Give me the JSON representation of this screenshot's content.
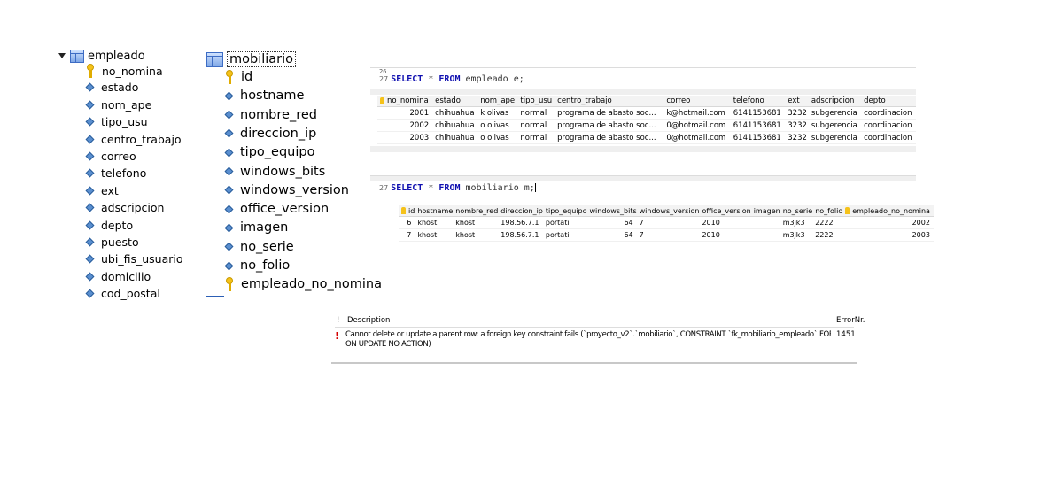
{
  "tree_empleado": {
    "title": "empleado",
    "columns": [
      {
        "name": "no_nomina",
        "icon": "primary-key-icon"
      },
      {
        "name": "estado",
        "icon": "column-icon"
      },
      {
        "name": "nom_ape",
        "icon": "column-icon"
      },
      {
        "name": "tipo_usu",
        "icon": "column-icon"
      },
      {
        "name": "centro_trabajo",
        "icon": "column-icon"
      },
      {
        "name": "correo",
        "icon": "column-icon"
      },
      {
        "name": "telefono",
        "icon": "column-icon"
      },
      {
        "name": "ext",
        "icon": "column-icon"
      },
      {
        "name": "adscripcion",
        "icon": "column-icon"
      },
      {
        "name": "depto",
        "icon": "column-icon"
      },
      {
        "name": "puesto",
        "icon": "column-icon"
      },
      {
        "name": "ubi_fis_usuario",
        "icon": "column-icon"
      },
      {
        "name": "domicilio",
        "icon": "column-icon"
      },
      {
        "name": "cod_postal",
        "icon": "column-icon"
      }
    ]
  },
  "tree_mobiliario": {
    "title": "mobiliario",
    "columns": [
      {
        "name": "id",
        "icon": "primary-key-icon"
      },
      {
        "name": "hostname",
        "icon": "column-icon"
      },
      {
        "name": "nombre_red",
        "icon": "column-icon"
      },
      {
        "name": "direccion_ip",
        "icon": "column-icon"
      },
      {
        "name": "tipo_equipo",
        "icon": "column-icon"
      },
      {
        "name": "windows_bits",
        "icon": "column-icon"
      },
      {
        "name": "windows_version",
        "icon": "column-icon"
      },
      {
        "name": "office_version",
        "icon": "column-icon"
      },
      {
        "name": "imagen",
        "icon": "column-icon"
      },
      {
        "name": "no_serie",
        "icon": "column-icon"
      },
      {
        "name": "no_folio",
        "icon": "column-icon"
      },
      {
        "name": "empleado_no_nomina",
        "icon": "foreign-key-icon"
      }
    ]
  },
  "query1": {
    "prev_line_no": "26",
    "line_no": "27",
    "kw_select": "SELECT",
    "star": "*",
    "kw_from": "FROM",
    "rest": "empleado e;",
    "headers": [
      "no_nomina",
      "estado",
      "nom_ape",
      "tipo_usu",
      "centro_trabajo",
      "correo",
      "telefono",
      "ext",
      "adscripcion",
      "depto"
    ],
    "rows": [
      [
        "2001",
        "chihuahua",
        "k olivas",
        "normal",
        "programa de abasto soc...",
        "k@hotmail.com",
        "6141153681",
        "3232",
        "subgerencia",
        "coordinacion"
      ],
      [
        "2002",
        "chihuahua",
        "o olivas",
        "normal",
        "programa de abasto soc...",
        "0@hotmail.com",
        "6141153681",
        "3232",
        "subgerencia",
        "coordinacion"
      ],
      [
        "2003",
        "chihuahua",
        "o olivas",
        "normal",
        "programa de abasto soc...",
        "0@hotmail.com",
        "6141153681",
        "3232",
        "subgerencia",
        "coordinacion"
      ]
    ]
  },
  "query2": {
    "line_no": "27",
    "kw_select": "SELECT",
    "star": "*",
    "kw_from": "FROM",
    "rest": "mobiliario m;",
    "headers": [
      "id",
      "hostname",
      "nombre_red",
      "direccion_ip",
      "tipo_equipo",
      "windows_bits",
      "windows_version",
      "office_version",
      "imagen",
      "no_serie",
      "no_folio",
      "empleado_no_nomina"
    ],
    "rows": [
      [
        "6",
        "khost",
        "khost",
        "198.56.7.1",
        "portatil",
        "64",
        "7",
        "2010",
        "",
        "m3jk3",
        "2222",
        "2002"
      ],
      [
        "7",
        "khost",
        "khost",
        "198.56.7.1",
        "portatil",
        "64",
        "7",
        "2010",
        "",
        "m3jk3",
        "2222",
        "2003"
      ]
    ]
  },
  "error_panel": {
    "header_mark": "!",
    "header_description": "Description",
    "header_errno": "ErrorNr.",
    "message_line1": "Cannot delete or update a parent row: a foreign key constraint fails (`proyecto_v2`.`mobiliario`, CONSTRAINT `fk_mobiliario_empleado` FOREIGN KEY (`empleado_no_nomina`) REFERENCES `empleado` (`no_nomina`)",
    "message_line2": "ON UPDATE NO ACTION)",
    "errno": "1451",
    "color_error": "#d40000"
  }
}
